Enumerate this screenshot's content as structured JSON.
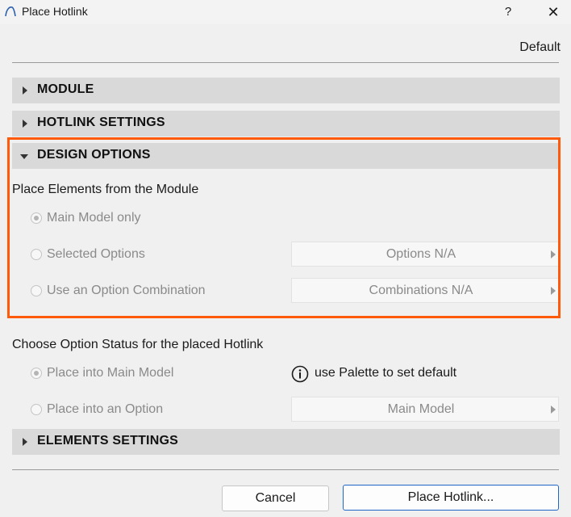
{
  "window": {
    "title": "Place Hotlink",
    "help_label": "?",
    "close_label": "✕"
  },
  "preset_label": "Default",
  "sections": {
    "module": "MODULE",
    "hotlink_settings": "HOTLINK SETTINGS",
    "design_options": "DESIGN OPTIONS",
    "elements_settings": "ELEMENTS SETTINGS"
  },
  "design_options": {
    "group_label": "Place Elements from the Module",
    "radios": [
      {
        "label": "Main Model only",
        "checked": true
      },
      {
        "label": "Selected Options",
        "checked": false
      },
      {
        "label": "Use an Option Combination",
        "checked": false
      }
    ],
    "options_dropdown": "Options N/A",
    "combinations_dropdown": "Combinations N/A"
  },
  "option_status": {
    "group_label": "Choose Option Status for the placed Hotlink",
    "radios": [
      {
        "label": "Place into Main Model",
        "checked": true
      },
      {
        "label": "Place into an Option",
        "checked": false
      }
    ],
    "info_text": "use Palette to set default",
    "option_dropdown": "Main Model"
  },
  "buttons": {
    "cancel": "Cancel",
    "place": "Place Hotlink..."
  },
  "colors": {
    "highlight": "#ff5a0a",
    "primary_border": "#1f66c9"
  }
}
